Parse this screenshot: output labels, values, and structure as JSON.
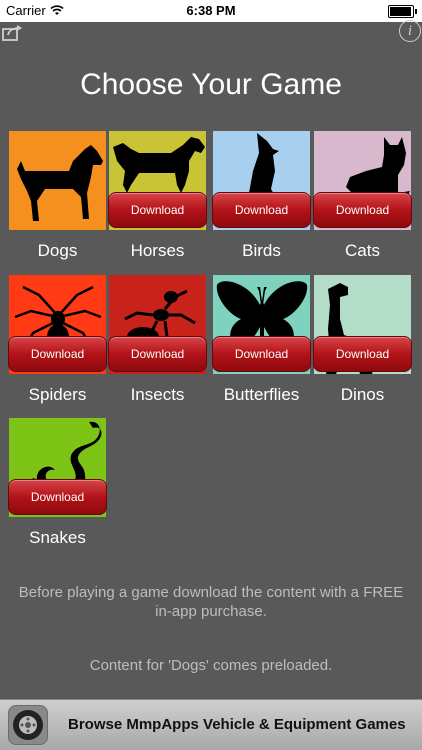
{
  "status_bar": {
    "carrier": "Carrier",
    "time": "6:38 PM",
    "battery_level": 0.95
  },
  "toolbar": {
    "share_icon": "share-icon",
    "info_icon": "info-icon",
    "info_glyph": "i"
  },
  "page_title": "Choose Your Game",
  "download_label": "Download",
  "games": [
    {
      "label": "Dogs",
      "bg": "#f5901e",
      "icon": "dog-silhouette-icon",
      "downloadable": false
    },
    {
      "label": "Horses",
      "bg": "#c9c436",
      "icon": "horse-silhouette-icon",
      "downloadable": true
    },
    {
      "label": "Birds",
      "bg": "#a8d0ee",
      "icon": "bird-silhouette-icon",
      "downloadable": true
    },
    {
      "label": "Cats",
      "bg": "#d8b8cc",
      "icon": "cat-silhouette-icon",
      "downloadable": true
    },
    {
      "label": "Spiders",
      "bg": "#ff3a14",
      "icon": "spider-silhouette-icon",
      "downloadable": true
    },
    {
      "label": "Insects",
      "bg": "#c8231a",
      "icon": "ant-silhouette-icon",
      "downloadable": true
    },
    {
      "label": "Butterflies",
      "bg": "#7fd2bd",
      "icon": "butterfly-silhouette-icon",
      "downloadable": true
    },
    {
      "label": "Dinos",
      "bg": "#b3dcc9",
      "icon": "dino-silhouette-icon",
      "downloadable": true
    },
    {
      "label": "Snakes",
      "bg": "#7dc417",
      "icon": "snake-silhouette-icon",
      "downloadable": true
    }
  ],
  "notes": {
    "purchase": "Before playing a game download the content with a FREE in-app purchase.",
    "preloaded": "Content for 'Dogs' comes preloaded."
  },
  "banner": {
    "text": "Browse MmpApps Vehicle & Equipment Games",
    "icon": "wheel-icon"
  }
}
